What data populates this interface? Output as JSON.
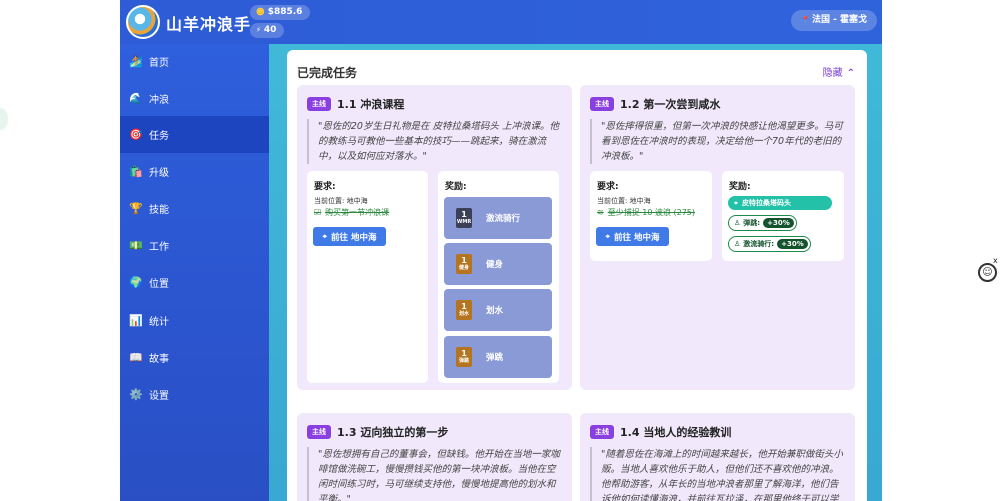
{
  "app": {
    "title": "山羊冲浪手",
    "money": "$885.6",
    "energy": "40",
    "location": "法国 - 霍塞戈"
  },
  "sidebar": {
    "items": [
      {
        "label": "首页",
        "icon": "🏄"
      },
      {
        "label": "冲浪",
        "icon": "🌊"
      },
      {
        "label": "任务",
        "icon": "🎯"
      },
      {
        "label": "升级",
        "icon": "🛍️"
      },
      {
        "label": "技能",
        "icon": "🏆"
      },
      {
        "label": "工作",
        "icon": "💵"
      },
      {
        "label": "位置",
        "icon": "🌍"
      },
      {
        "label": "统计",
        "icon": "📊"
      },
      {
        "label": "故事",
        "icon": "📖"
      },
      {
        "label": "设置",
        "icon": "⚙️"
      }
    ],
    "active": "任务"
  },
  "panel": {
    "title": "已完成任务",
    "hide_label": "隐藏"
  },
  "labels": {
    "requirements": "要求:",
    "rewards": "奖励:",
    "tag": "主线"
  },
  "quests": [
    {
      "title": "1.1 冲浪课程",
      "quote": "\"恩佐的20岁生日礼物是在 皮特拉桑塔码头 上冲浪课。他的教练马可教他一些基本的技巧——跳起来，骑在激流中，以及如何应对落水。\"",
      "current_location": "当前位置: 地中海",
      "requirement": "购买第一节冲浪课",
      "go_button": "前往 地中海",
      "skill_rewards": [
        {
          "level": "1",
          "abbr": "WMR",
          "name": "激流骑行",
          "color": "#3b3f58"
        },
        {
          "level": "1",
          "abbr": "健身",
          "name": "健身",
          "color": "#b5741f"
        },
        {
          "level": "1",
          "abbr": "划水",
          "name": "划水",
          "color": "#b5741f"
        },
        {
          "level": "1",
          "abbr": "弹跳",
          "name": "弹跳",
          "color": "#b5741f"
        }
      ]
    },
    {
      "title": "1.2 第一次尝到咸水",
      "quote": "\"恩佐摔得很重，但第一次冲浪的快感让他渴望更多。马可看到恩佐在冲浪时的表现，决定给他一个70年代的老旧的冲浪板。\"",
      "current_location": "当前位置: 地中海",
      "requirement": "至少捕捉 10 波浪 (275)",
      "go_button": "前往 地中海",
      "location_reward": "皮特拉桑塔码头",
      "boosts": [
        {
          "name": "弹跳:",
          "value": "+30%"
        },
        {
          "name": "激流骑行:",
          "value": "+30%"
        }
      ]
    },
    {
      "title": "1.3 迈向独立的第一步",
      "quote": "\"恩佐想拥有自己的董事会，但缺钱。他开始在当地一家咖啡馆做洗碗工，慢慢攒钱买他的第一块冲浪板。当他在空闲时间练习时，马可继续支持他，慢慢地提高他的划水和平衡。\""
    },
    {
      "title": "1.4 当地人的经验教训",
      "quote": "\"随着恩佐在海滩上的时间越来越长，他开始兼职做街头小贩。当地人喜欢他乐于助人，但他们还不喜欢他的冲浪。他帮助游客，从年长的当地冲浪者那里了解海洋，他们告诉他如何读懂海浪，并前往瓦拉泽，在那里他终于可以学会在绿"
    }
  ]
}
